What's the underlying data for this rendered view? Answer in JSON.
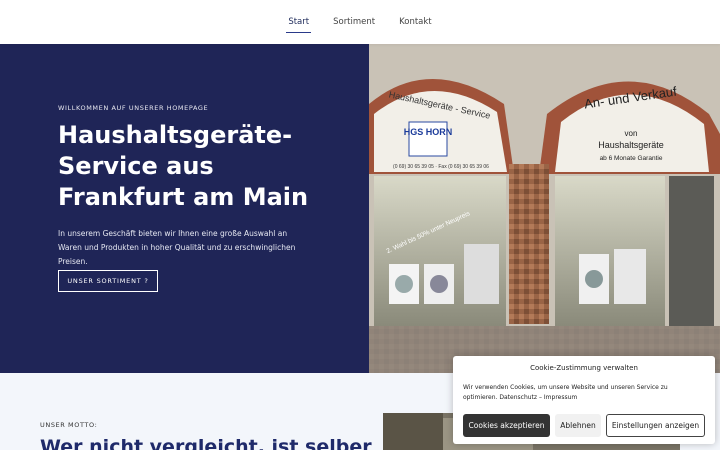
{
  "nav": {
    "items": [
      {
        "label": "Start",
        "active": true
      },
      {
        "label": "Sortiment",
        "active": false
      },
      {
        "label": "Kontakt",
        "active": false
      }
    ]
  },
  "hero": {
    "eyebrow": "WILLKOMMEN AUF UNSERER HOMEPAGE",
    "title": "Haushaltsgeräte-Service aus Frankfurt am Main",
    "text": "In unserem Geschäft bieten wir Ihnen eine große Auswahl an Waren und Produkten in hoher Qualität und zu erschwinglichen Preisen.",
    "button_label": "UNSER SORTIMENT ?",
    "photo": {
      "left_arch_text": "Haushaltsgeräte - Service",
      "sign_text": "HGS HORN",
      "phone_text": "(0 69) 30 65 39 05 · Fax (0 69) 30 65 39 06",
      "right_arch_line1": "An- und Verkauf",
      "right_arch_line2": "von",
      "right_arch_line3": "Haushaltsgeräte",
      "right_arch_line4": "ab 6 Monate Garantie",
      "window_note": "2. Wahl bis 50% unter Neupreis"
    }
  },
  "section2": {
    "label": "UNSER MOTTO:",
    "title": "Wer nicht vergleicht, ist selber"
  },
  "cookie": {
    "title": "Cookie-Zustimmung verwalten",
    "text": "Wir verwenden Cookies, um unsere Website und unseren Service zu optimieren.",
    "link_privacy": "Datenschutz",
    "link_separator": "–",
    "link_imprint": "Impressum",
    "accept_label": "Cookies akzeptieren",
    "deny_label": "Ablehnen",
    "prefs_label": "Einstellungen anzeigen"
  },
  "colors": {
    "hero_bg": "#1f2557",
    "accent": "#1f2a6a",
    "section_bg": "#f3f6fb"
  }
}
